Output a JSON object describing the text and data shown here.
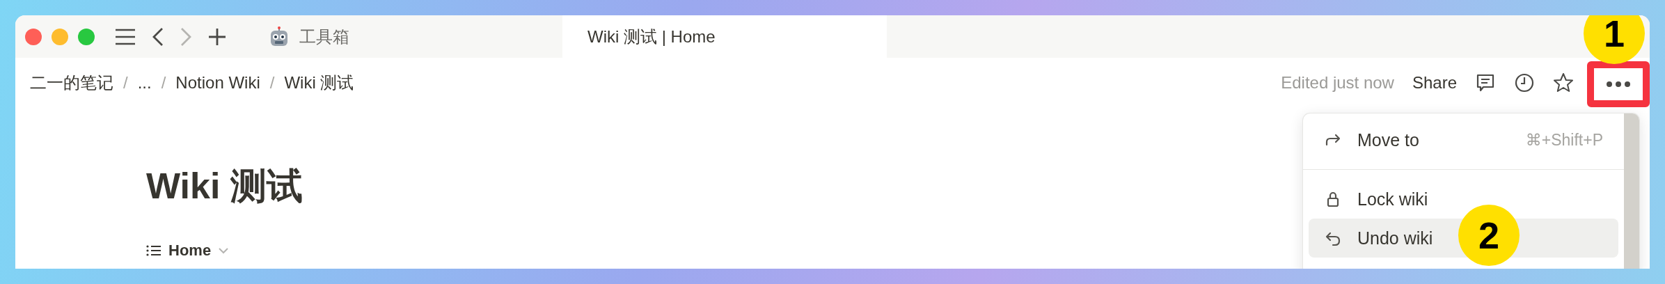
{
  "tabs": [
    {
      "label": "工具箱",
      "selected": false
    },
    {
      "label": "Wiki 测试 | Home",
      "selected": true
    }
  ],
  "breadcrumbs": {
    "separator": "/",
    "items": [
      "二一的笔记",
      "...",
      "Notion Wiki",
      "Wiki 测试"
    ]
  },
  "topbar": {
    "status": "Edited just now",
    "share": "Share"
  },
  "page": {
    "title": "Wiki 测试",
    "view": "Home"
  },
  "menu": {
    "sections": [
      [
        {
          "label": "Move to",
          "shortcut": "⌘+Shift+P",
          "selected": false
        }
      ],
      [
        {
          "label": "Lock wiki",
          "selected": false
        },
        {
          "label": "Undo wiki",
          "selected": true
        }
      ]
    ]
  },
  "callouts": [
    "1",
    "2"
  ]
}
